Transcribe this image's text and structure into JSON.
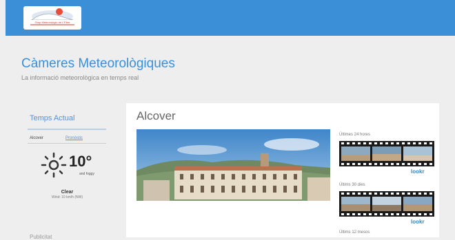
{
  "header": {
    "logo_text": "Grup Meteorològic de L'Ebre"
  },
  "site": {
    "title": "Càmeres Meteorològiques",
    "subtitle": "La informació meteorològica en temps real"
  },
  "sidebar": {
    "heading": "Temps Actual",
    "tabs": [
      "Alcover",
      "Pronòstic"
    ],
    "weather": {
      "temperature": "10°",
      "temp_note": "and foggy",
      "condition": "Clear",
      "condition_note": "Wind: 10 km/h (NW)",
      "icon": "sun-icon"
    },
    "next_heading": "Publicitat"
  },
  "main": {
    "title": "Alcover",
    "cameras": [
      {
        "label": "Últimes 24 hores",
        "brand": "lookr"
      },
      {
        "label": "Últims 30 dies",
        "brand": "lookr"
      },
      {
        "label": "Últims 12 mesos"
      }
    ]
  }
}
